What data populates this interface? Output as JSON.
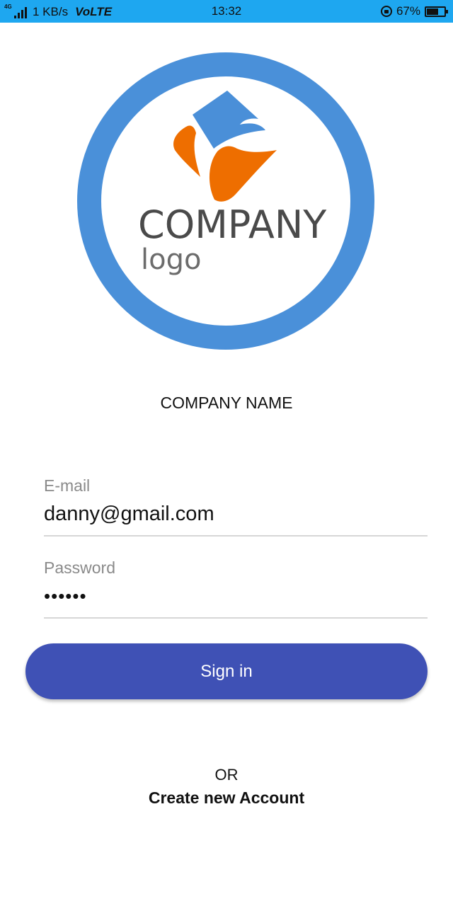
{
  "status_bar": {
    "network_type": "4G",
    "speed": "1 KB/s",
    "volte": "VoLTE",
    "time": "13:32",
    "battery_percent_label": "67%",
    "battery_level": 0.67,
    "background_color": "#1ea7f0"
  },
  "logo": {
    "word": "COMPANY",
    "sub": "logo",
    "ring_color": "#4a90d9",
    "accent_blue": "#4a8fd8",
    "accent_orange": "#ee6e00"
  },
  "company_name": "COMPANY NAME",
  "form": {
    "email": {
      "label": "E-mail",
      "value": "danny@gmail.com"
    },
    "password": {
      "label": "Password",
      "value": "••••••"
    },
    "signin_label": "Sign in",
    "button_color": "#3f51b5"
  },
  "footer": {
    "or_text": "OR",
    "create_account": "Create new Account"
  }
}
